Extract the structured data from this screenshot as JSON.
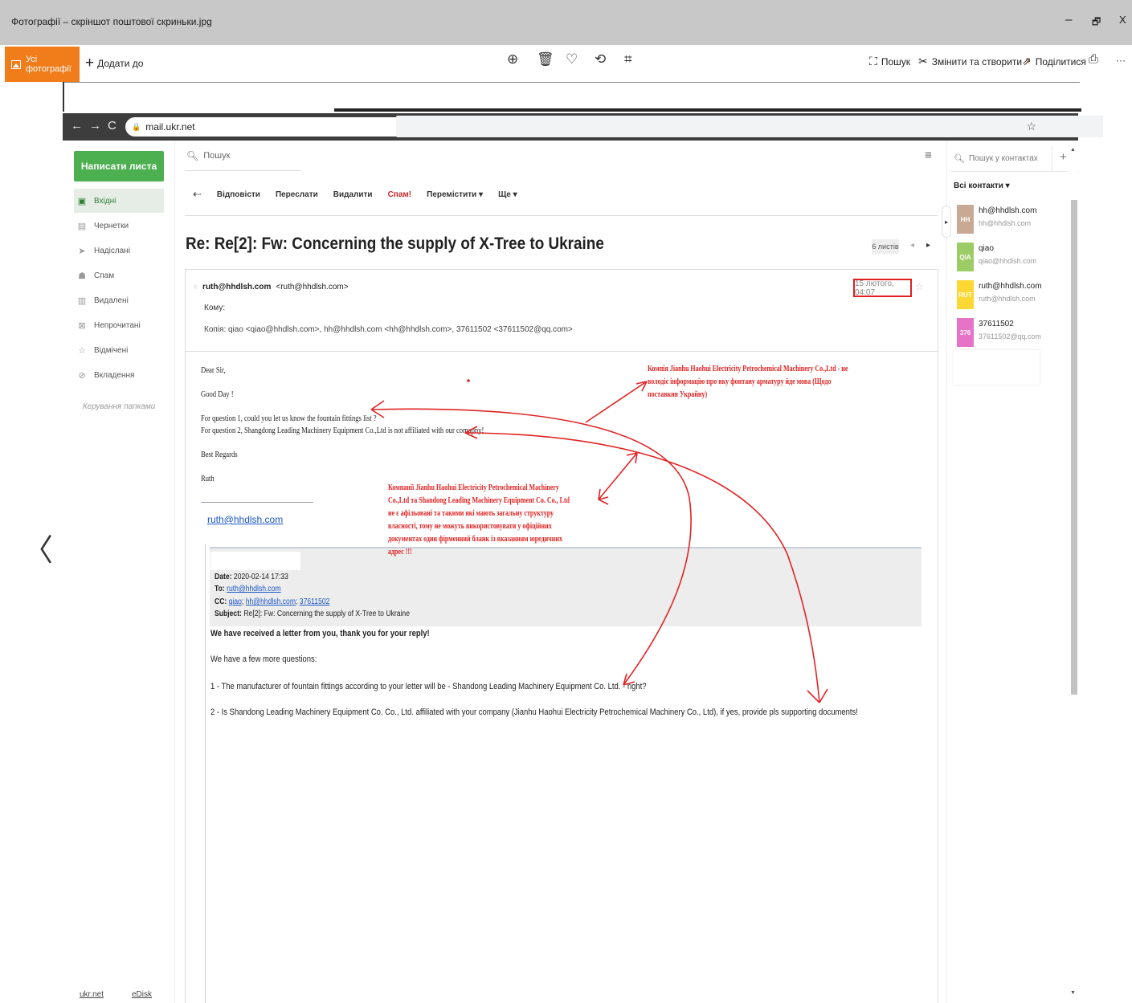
{
  "window": {
    "title": "Фотографії – скріншот поштової скриньки.jpg",
    "minimize": "–",
    "restore": "🗗",
    "close": "X"
  },
  "photos_toolbar": {
    "all_photos": "Усі фотографії",
    "add_to": "Додати до",
    "search": "Пошук",
    "edit_create": "Змінити та створити",
    "share": "Поділитися",
    "more": "···"
  },
  "browser": {
    "url": "mail.ukr.net"
  },
  "mail_sidebar": {
    "compose": "Написати листа",
    "folders": [
      {
        "label": "Вхідні",
        "icon": "inbox-icon",
        "glyph": "▣"
      },
      {
        "label": "Чернетки",
        "icon": "draft-icon",
        "glyph": "▤"
      },
      {
        "label": "Надіслані",
        "icon": "sent-icon",
        "glyph": "➤"
      },
      {
        "label": "Спам",
        "icon": "spam-icon",
        "glyph": "☗"
      },
      {
        "label": "Видалені",
        "icon": "trash-icon",
        "glyph": "▥"
      },
      {
        "label": "Непрочитані",
        "icon": "unread-icon",
        "glyph": "⊠"
      },
      {
        "label": "Відмічені",
        "icon": "star-icon",
        "glyph": "☆"
      },
      {
        "label": "Вкладення",
        "icon": "attachment-icon",
        "glyph": "⊘"
      }
    ],
    "manage": "Керування папками",
    "footer": [
      "ukr.net",
      "eDisk"
    ]
  },
  "mail": {
    "search_placeholder": "Пошук",
    "actions": {
      "reply": "Відповісти",
      "forward": "Переслати",
      "delete": "Видалити",
      "spam": "Спам!",
      "move": "Перемістити ▾",
      "more": "Ще ▾"
    },
    "subject": "Re: Re[2]: Fw: Concerning the supply of X-Tree to Ukraine",
    "thread_count": "6 листів",
    "from_name": "ruth@hhdlsh.com",
    "from_addr": "<ruth@hhdlsh.com>",
    "to_label": "Кому:",
    "cc_line": "Копія: qiao <qiao@hhdlsh.com>,   hh@hhdlsh.com <hh@hhdlsh.com>,   37611502 <37611502@qq.com>",
    "date": "15 лютого, 04:07",
    "body": [
      "Dear Sir,",
      "Good Day !",
      "For question 1, could you let us know the fountain fittings list ?",
      "For question 2, Shangdong Leading Machinery Equipment Co.,Ltd is not affiliated with our comapny!",
      "Best Regards",
      "Ruth"
    ],
    "signature_link": "ruth@hhdlsh.com",
    "quoted": {
      "date_label": "Date:",
      "date_value": "2020-02-14 17:33",
      "to_label": "To:",
      "to_value": "ruth@hhdlsh.com",
      "cc_label": "CC:",
      "cc_values": [
        "qiao",
        "hh@hhdlsh.com",
        "37611502"
      ],
      "subject_label": "Subject:",
      "subject_value": "Re[2]: Fw: Concerning the supply of X-Tree to Ukraine",
      "lines": [
        "We have received a letter from you, thank you for your reply!",
        "We have a few more questions:",
        "1 - The manufacturer of fountain fittings according to your letter will be - Shandong Leading Machinery Equipment Co. Ltd. - right?",
        "2 - Is Shandong Leading Machinery Equipment Co. Co., Ltd. affiliated with your company (Jianhu Haohui Electricity Petrochemical Machinery Co., Ltd), if yes,  provide pls supporting documents!"
      ]
    }
  },
  "annotations": {
    "note1": [
      "Компія Jianhu Haohui Electricity  Petrochemical Machinery Co.,Ltd - не",
      "володіє інформацію про яку фонтану арматуру йде мова (Щодо",
      "поставкив Украйну)"
    ],
    "note2": [
      "Компанії Jianhu Haohui Electricity  Petrochemical Machinery",
      "Co.,Ltd та Shandong Leading Machinery Equipment Co. Co., Ltd",
      "не є афільовані та такими які мають загальну структуру",
      "власності, тому не можуть використовувати у офіційних",
      "документах один фірменний бланк із вказанням юредичних",
      "адрес !!!"
    ]
  },
  "contacts": {
    "search_placeholder": "Пошук у контактах",
    "all_label": "Всі контакти ▾",
    "list": [
      {
        "initials": "HH",
        "name": "hh@hhdlsh.com",
        "email": "hh@hhdlsh.com",
        "color": "#c8a994"
      },
      {
        "initials": "QIA",
        "name": "qiao",
        "email": "qiao@hhdlsh.com",
        "color": "#9ccc65"
      },
      {
        "initials": "RUT",
        "name": "ruth@hhdlsh.com",
        "email": "ruth@hhdlsh.com",
        "color": "#fdd835"
      },
      {
        "initials": "376",
        "name": "37611502",
        "email": "37611502@qq.com",
        "color": "#e573c8"
      }
    ]
  }
}
